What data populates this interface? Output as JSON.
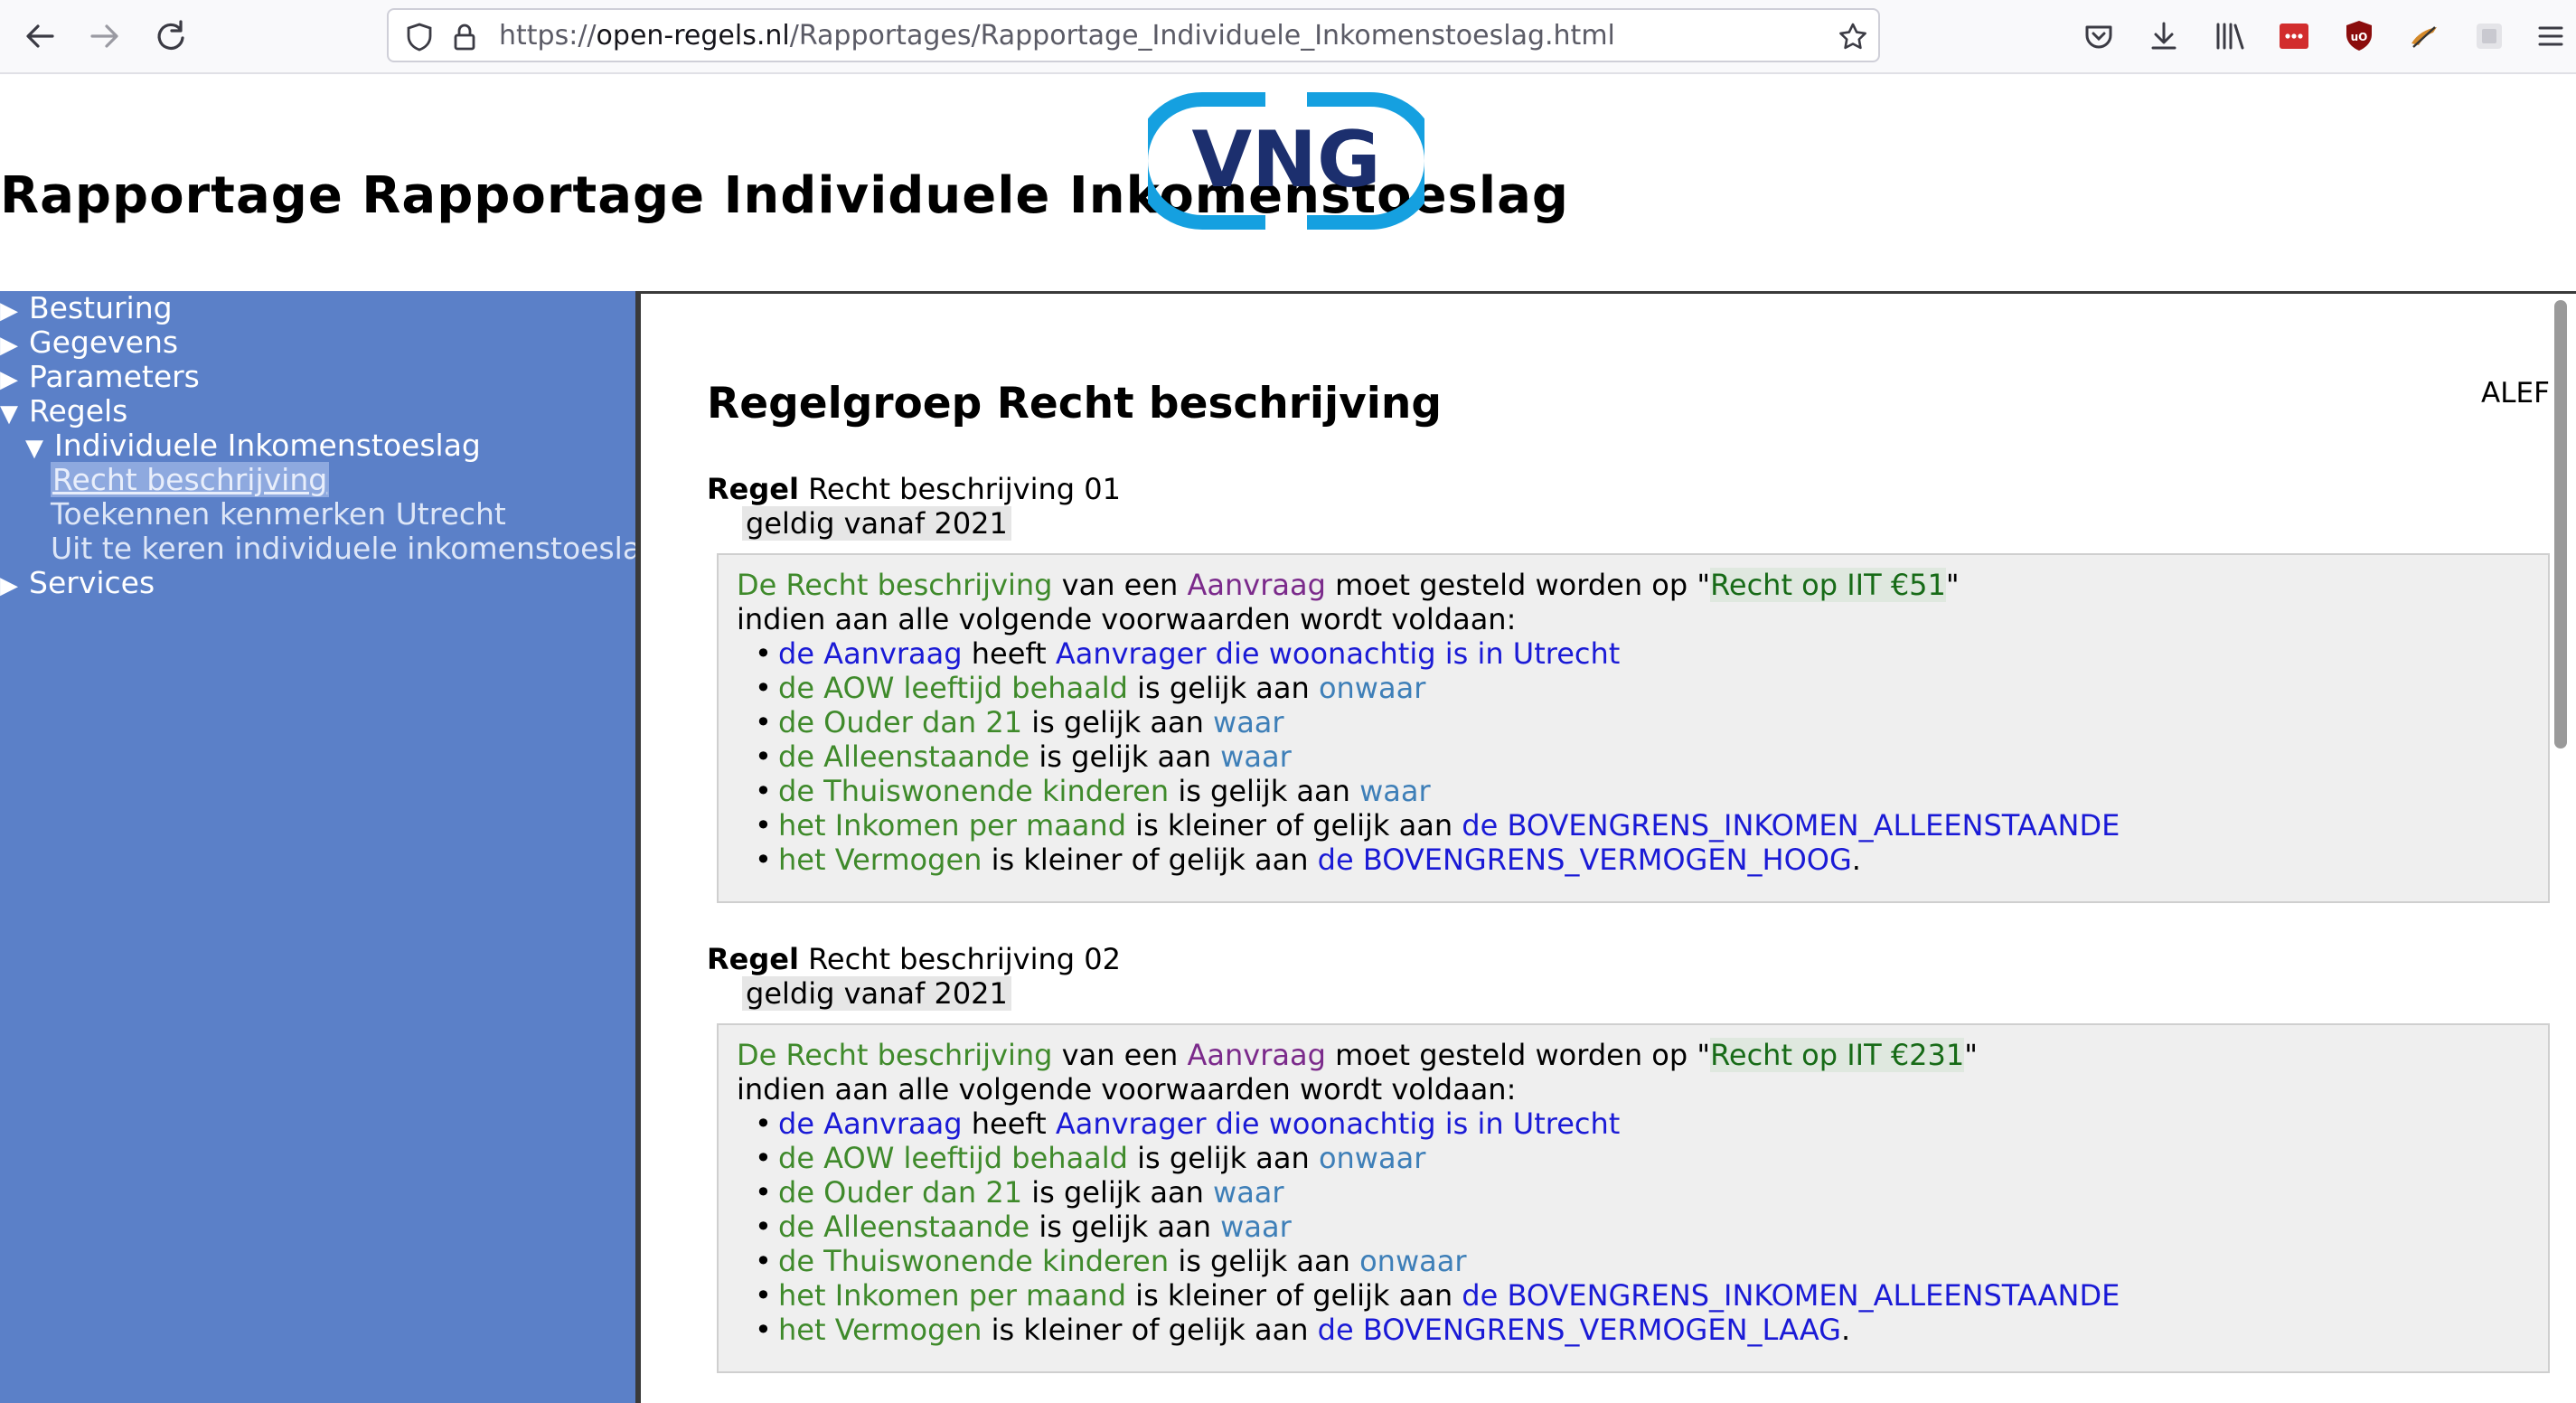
{
  "browser": {
    "url_prefix": "https://",
    "url_host": "open-regels.nl",
    "url_path": "/Rapportages/Rapportage_Individuele_Inkomenstoeslag.html"
  },
  "page": {
    "title": "Rapportage Rapportage Individuele Inkomenstoeslag",
    "logo_text": "VNG"
  },
  "sidebar": {
    "items": [
      {
        "label": "Besturing",
        "expanded": false
      },
      {
        "label": "Gegevens",
        "expanded": false
      },
      {
        "label": "Parameters",
        "expanded": false
      },
      {
        "label": "Regels",
        "expanded": true
      },
      {
        "label": "Individuele Inkomenstoeslag",
        "expanded": true
      },
      {
        "label": "Recht beschrijving",
        "selected": true
      },
      {
        "label": "Toekennen kenmerken Utrecht"
      },
      {
        "label": "Uit te keren individuele inkomenstoeslag"
      },
      {
        "label": "Services",
        "expanded": false
      }
    ]
  },
  "main": {
    "section_prefix": "Regelgroep",
    "section_name": "Recht beschrijving",
    "alef": "ALEF",
    "rules": [
      {
        "keyword": "Regel",
        "name": "Recht beschrijving 01",
        "validity": "geldig vanaf 2021",
        "head": {
          "subject": "De Recht beschrijving",
          "of": "van een",
          "object": "Aanvraag",
          "verb": "moet gesteld worden op \"",
          "value": "Recht op IIT €51",
          "close": "\""
        },
        "condition_intro": "indien aan alle volgende voorwaarden wordt voldaan:",
        "conditions": [
          {
            "a": "de Aanvraag",
            "op": "heeft",
            "b": "Aanvrager die woonachtig is in Utrecht",
            "end": ""
          },
          {
            "a": "de AOW leeftijd behaald",
            "op": "is gelijk aan",
            "b": "onwaar",
            "end": ""
          },
          {
            "a": "de Ouder dan 21",
            "op": "is gelijk aan",
            "b": "waar",
            "end": ""
          },
          {
            "a": "de Alleenstaande",
            "op": "is gelijk aan",
            "b": "waar",
            "end": ""
          },
          {
            "a": "de Thuiswonende kinderen",
            "op": "is gelijk aan",
            "b": "waar",
            "end": ""
          },
          {
            "a": "het Inkomen per maand",
            "op": "is kleiner of gelijk aan",
            "b": "de BOVENGRENS_INKOMEN_ALLEENSTAANDE",
            "end": ""
          },
          {
            "a": "het Vermogen",
            "op": "is kleiner of gelijk aan",
            "b": "de BOVENGRENS_VERMOGEN_HOOG",
            "end": "."
          }
        ]
      },
      {
        "keyword": "Regel",
        "name": "Recht beschrijving 02",
        "validity": "geldig vanaf 2021",
        "head": {
          "subject": "De Recht beschrijving",
          "of": "van een",
          "object": "Aanvraag",
          "verb": "moet gesteld worden op \"",
          "value": "Recht op IIT €231",
          "close": "\""
        },
        "condition_intro": "indien aan alle volgende voorwaarden wordt voldaan:",
        "conditions": [
          {
            "a": "de Aanvraag",
            "op": "heeft",
            "b": "Aanvrager die woonachtig is in Utrecht",
            "end": ""
          },
          {
            "a": "de AOW leeftijd behaald",
            "op": "is gelijk aan",
            "b": "onwaar",
            "end": ""
          },
          {
            "a": "de Ouder dan 21",
            "op": "is gelijk aan",
            "b": "waar",
            "end": ""
          },
          {
            "a": "de Alleenstaande",
            "op": "is gelijk aan",
            "b": "waar",
            "end": ""
          },
          {
            "a": "de Thuiswonende kinderen",
            "op": "is gelijk aan",
            "b": "onwaar",
            "end": ""
          },
          {
            "a": "het Inkomen per maand",
            "op": "is kleiner of gelijk aan",
            "b": "de BOVENGRENS_INKOMEN_ALLEENSTAANDE",
            "end": ""
          },
          {
            "a": "het Vermogen",
            "op": "is kleiner of gelijk aan",
            "b": "de BOVENGRENS_VERMOGEN_LAAG",
            "end": "."
          }
        ]
      }
    ]
  }
}
